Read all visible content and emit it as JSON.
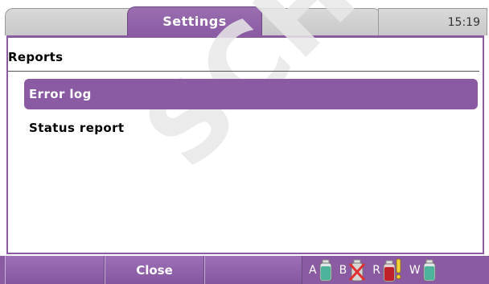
{
  "tabs": {
    "active_label": "Settings",
    "clock": "15:19"
  },
  "section": {
    "title": "Reports"
  },
  "list": {
    "items": [
      {
        "label": "Error log",
        "selected": true
      },
      {
        "label": "Status report",
        "selected": false
      }
    ]
  },
  "softkeys": {
    "center_label": "Close"
  },
  "bottles": [
    {
      "letter": "A",
      "status": "ok",
      "color": "#4db39a"
    },
    {
      "letter": "B",
      "status": "missing",
      "color": "#cccccc"
    },
    {
      "letter": "R",
      "status": "warning",
      "color": "#c0202a"
    },
    {
      "letter": "W",
      "status": "ok",
      "color": "#4db39a"
    }
  ],
  "watermark": "SCHER",
  "colors": {
    "accent": "#8a5aa3"
  }
}
